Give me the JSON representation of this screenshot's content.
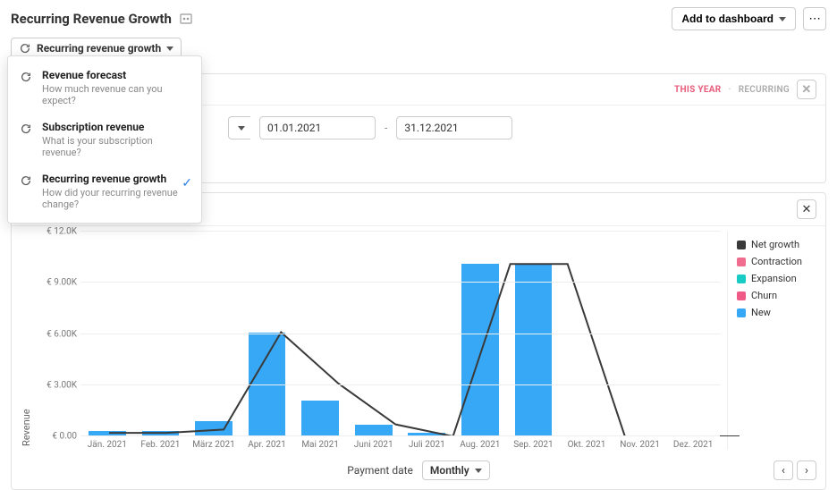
{
  "header": {
    "title": "Recurring Revenue Growth",
    "add_to_dashboard": "Add to dashboard",
    "more_label": "⋯"
  },
  "metric_select": {
    "label": "Recurring revenue growth",
    "options": [
      {
        "label": "Revenue forecast",
        "desc": "How much revenue can you expect?",
        "selected": false
      },
      {
        "label": "Subscription revenue",
        "desc": "What is your subscription revenue?",
        "selected": false
      },
      {
        "label": "Recurring revenue growth",
        "desc": "How did your recurring revenue change?",
        "selected": true
      }
    ]
  },
  "panel": {
    "filter_chip_1": "THIS YEAR",
    "filter_chip_2": "RECURRING",
    "close_label": "✕",
    "date_from": "01.01.2021",
    "date_to": "31.12.2021",
    "date_sep": "-"
  },
  "chart_toolbar": {
    "bar_icon": "bar-chart",
    "table_icon": "table",
    "close_label": "✕"
  },
  "legend": [
    {
      "name": "Net growth",
      "color": "#3a3a3a"
    },
    {
      "name": "Contraction",
      "color": "#f06d8f"
    },
    {
      "name": "Expansion",
      "color": "#18cbc5"
    },
    {
      "name": "Churn",
      "color": "#ef5a86"
    },
    {
      "name": "New",
      "color": "#36a8f5"
    }
  ],
  "axes": {
    "ylabel": "Revenue",
    "xlabel": "Payment date",
    "interval_label": "Monthly"
  },
  "chart_data": {
    "type": "bar",
    "categories": [
      "Jän. 2021",
      "Feb. 2021",
      "März 2021",
      "Apr. 2021",
      "Mai 2021",
      "Juni 2021",
      "Juli 2021",
      "Aug. 2021",
      "Sep. 2021",
      "Okt. 2021",
      "Nov. 2021",
      "Dez. 2021"
    ],
    "ylim": [
      0,
      12000
    ],
    "ytick_labels": [
      "€ 0.00",
      "€ 3.00K",
      "€ 6.00K",
      "€ 9.00K",
      "€ 12.0K"
    ],
    "series": [
      {
        "name": "New",
        "color": "#36a8f5",
        "values": [
          300,
          300,
          900,
          6100,
          2100,
          700,
          200,
          10100,
          10100,
          0,
          0,
          0
        ]
      },
      {
        "name": "Net growth",
        "color": "#3a3a3a",
        "type": "line",
        "values": [
          200,
          200,
          400,
          6100,
          3100,
          700,
          -100,
          10100,
          10100,
          0,
          0,
          0
        ]
      }
    ]
  }
}
